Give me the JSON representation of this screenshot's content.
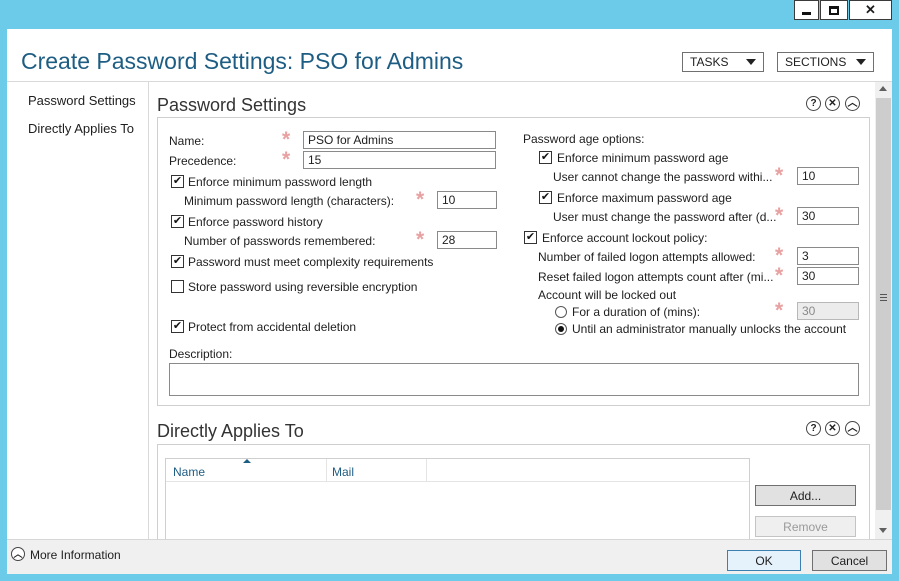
{
  "window": {
    "minimize_icon": "minimize-icon",
    "maximize_icon": "maximize-icon",
    "close_icon": "close-icon"
  },
  "header": {
    "title": "Create Password Settings: PSO for Admins",
    "tasks_label": "TASKS",
    "sections_label": "SECTIONS"
  },
  "nav": {
    "items": [
      {
        "label": "Password Settings"
      },
      {
        "label": "Directly Applies To"
      }
    ]
  },
  "password_settings": {
    "heading": "Password Settings",
    "name_label": "Name:",
    "name_value": "PSO for Admins",
    "precedence_label": "Precedence:",
    "precedence_value": "15",
    "enforce_min_length_label": "Enforce minimum password length",
    "enforce_min_length_checked": true,
    "min_length_label": "Minimum password length (characters):",
    "min_length_value": "10",
    "enforce_history_label": "Enforce password history",
    "enforce_history_checked": true,
    "remembered_label": "Number of passwords remembered:",
    "remembered_value": "28",
    "complexity_label": "Password must meet complexity requirements",
    "complexity_checked": true,
    "reversible_label": "Store password using reversible encryption",
    "reversible_checked": false,
    "protect_label": "Protect from accidental deletion",
    "protect_checked": true,
    "description_label": "Description:",
    "description_value": "",
    "age_options_label": "Password age options:",
    "enforce_min_age_label": "Enforce minimum password age",
    "enforce_min_age_checked": true,
    "min_age_label": "User cannot change the password withi...",
    "min_age_value": "10",
    "enforce_max_age_label": "Enforce maximum password age",
    "enforce_max_age_checked": true,
    "max_age_label": "User must change the password after (d...",
    "max_age_value": "30",
    "lockout_label": "Enforce account lockout policy:",
    "lockout_checked": true,
    "failed_attempts_label": "Number of failed logon attempts allowed:",
    "failed_attempts_value": "3",
    "reset_label": "Reset failed logon attempts count after (mi...",
    "reset_value": "30",
    "locked_out_label": "Account will be locked out",
    "duration_label": "For a duration of (mins):",
    "duration_value": "30",
    "duration_selected": false,
    "until_admin_label": "Until an administrator manually unlocks the account",
    "until_admin_selected": true
  },
  "applies_to": {
    "heading": "Directly Applies To",
    "col_name": "Name",
    "col_mail": "Mail",
    "add_label": "Add...",
    "remove_label": "Remove"
  },
  "footer": {
    "more_info_label": "More Information",
    "ok_label": "OK",
    "cancel_label": "Cancel"
  }
}
